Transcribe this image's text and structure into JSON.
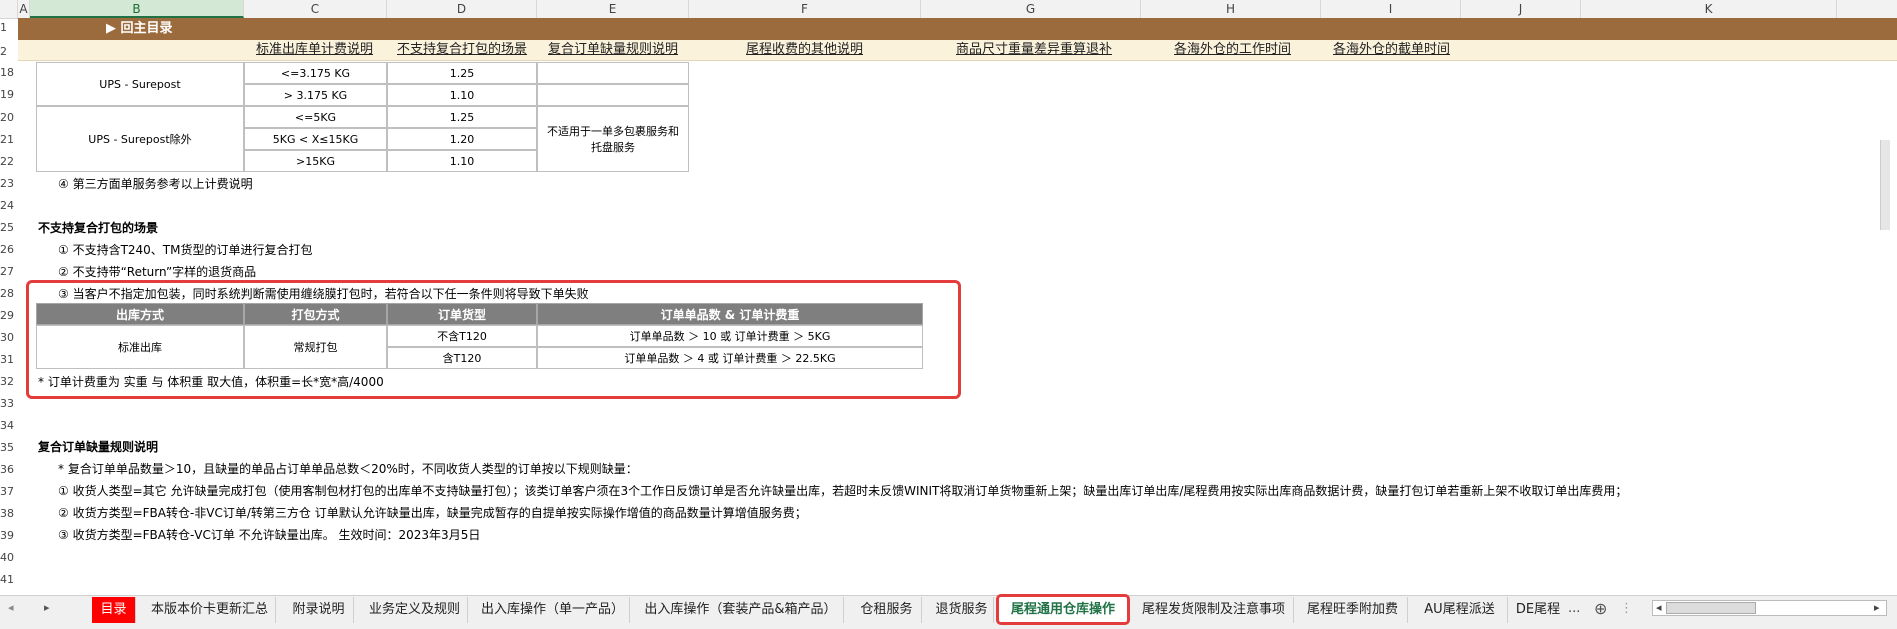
{
  "columns": [
    "A",
    "B",
    "C",
    "D",
    "E",
    "F",
    "G",
    "H",
    "I",
    "J",
    "K"
  ],
  "selected_column": "B",
  "row_numbers": [
    "1",
    "2",
    "18",
    "19",
    "20",
    "21",
    "22",
    "23",
    "24",
    "25",
    "26",
    "27",
    "28",
    "29",
    "30",
    "31",
    "32",
    "33",
    "34",
    "35",
    "36",
    "37",
    "38",
    "39",
    "40",
    "41"
  ],
  "back_to_menu": "▶ 回主目录",
  "section_links": [
    "标准出库单计费说明",
    "不支持复合打包的场景",
    "复合订单缺量规则说明",
    "尾程收费的其他说明",
    "商品尺寸重量差异重算退补",
    "各海外仓的工作时间",
    "各海外仓的截单时间"
  ],
  "ups_table": {
    "surepost": {
      "name": "UPS - Surepost",
      "rows": [
        {
          "weight": "<=3.175 KG",
          "factor": "1.25"
        },
        {
          "weight": "> 3.175 KG",
          "factor": "1.10"
        }
      ]
    },
    "surepost_excl": {
      "name": "UPS - Surepost除外",
      "rows": [
        {
          "weight": "<=5KG",
          "factor": "1.25"
        },
        {
          "weight": "5KG < X≤15KG",
          "factor": "1.20"
        },
        {
          "weight": ">15KG",
          "factor": "1.10"
        }
      ],
      "note": "不适用于一单多包裹服务和托盘服务"
    }
  },
  "note_third_party": "④ 第三方面单服务参考以上计费说明",
  "unsupported": {
    "title": "不支持复合打包的场景",
    "items": [
      "① 不支持含T240、TM货型的订单进行复合打包",
      "② 不支持带“Return”字样的退货商品",
      "③ 当客户不指定加包装，同时系统判断需使用缠绕膜打包时，若符合以下任一条件则将导致下单失败"
    ],
    "headers": [
      "出库方式",
      "打包方式",
      "订单货型",
      "订单单品数 & 订单计费重"
    ],
    "outbound": "标准出库",
    "packing": "常规打包",
    "rows": [
      {
        "type": "不含T120",
        "cond": "订单单品数 ＞ 10 或 订单计费重 ＞ 5KG"
      },
      {
        "type": "含T120",
        "cond": "订单单品数 ＞ 4 或 订单计费重 ＞ 22.5KG"
      }
    ],
    "footnote": "* 订单计费重为 实重 与 体积重 取大值，体积重=长*宽*高/4000"
  },
  "shortage": {
    "title": "复合订单缺量规则说明",
    "lines": [
      "* 复合订单单品数量＞10，且缺量的单品占订单单品总数＜20%时，不同收货人类型的订单按以下规则缺量：",
      "① 收货人类型=其它 允许缺量完成打包（使用客制包材打包的出库单不支持缺量打包）；该类订单客户须在3个工作日反馈订单是否允许缺量出库，若超时未反馈WINIT将取消订单货物重新上架；缺量出库订单出库/尾程费用按实际出库商品数据计费，缺量打包订单若重新上架不收取订单出库费用；",
      "② 收货方类型=FBA转仓-非VC订单/转第三方仓 订单默认允许缺量出库，缺量完成暂存的自提单按实际操作增值的商品数量计算增值服务费；",
      "③ 收货方类型=FBA转仓-VC订单 不允许缺量出库。   生效时间：2023年3月5日"
    ]
  },
  "tabs": [
    "目录",
    "本版本价卡更新汇总",
    "附录说明",
    "业务定义及规则",
    "出入库操作（单一产品）",
    "出入库操作（套装产品&箱产品）",
    "仓租服务",
    "退货服务",
    "尾程通用仓库操作",
    "尾程发货限制及注意事项",
    "尾程旺季附加费",
    "AU尾程派送",
    "DE尾程"
  ],
  "active_tab": "尾程通用仓库操作",
  "tab_more": "...",
  "add_sheet": "⊕"
}
